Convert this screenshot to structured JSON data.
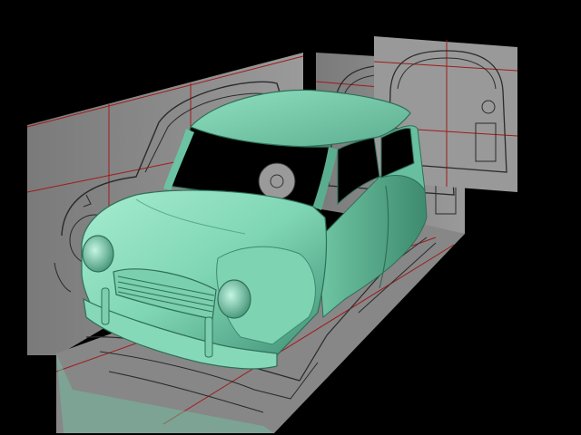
{
  "scene": {
    "background_color": "#000000",
    "body_color": "#7fd6b4",
    "body_shadow_color": "#3f8f74",
    "blueprint_panel_color": "#8e8e8e",
    "blueprint_line_color": "#2a2a2a",
    "guide_line_color": "#b01818",
    "floor_panel_color": "#8c8c8c"
  }
}
